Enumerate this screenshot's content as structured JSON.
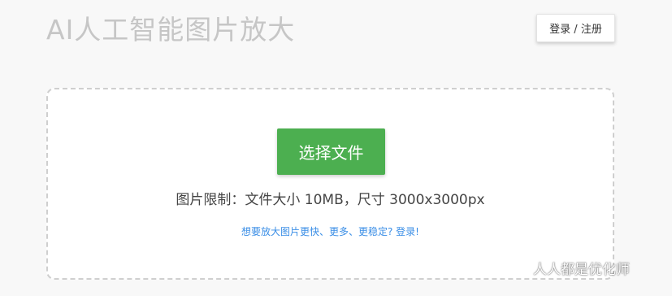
{
  "header": {
    "title": "AI人工智能图片放大",
    "login_register_label": "登录 / 注册"
  },
  "upload": {
    "select_file_label": "选择文件",
    "limit_text": "图片限制：文件大小 10MB，尺寸 3000x3000px",
    "login_promo_text": "想要放大图片更快、更多、更稳定? 登录!"
  },
  "watermark": {
    "icon": "wechat-icon",
    "text": "人人都是优化师"
  },
  "colors": {
    "accent_green": "#4caf50",
    "link_blue": "#3a8ee6",
    "title_gray": "#c6c6c6"
  }
}
